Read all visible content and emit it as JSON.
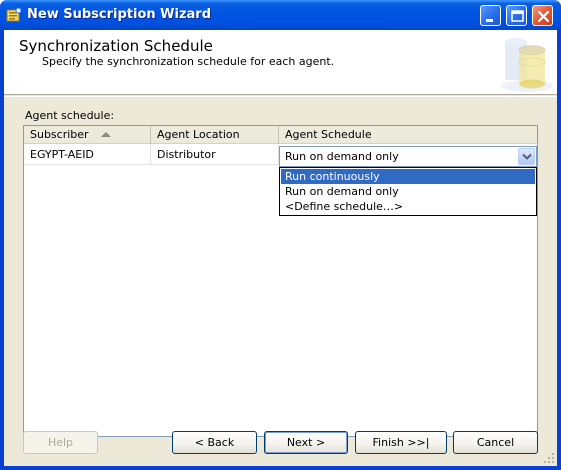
{
  "window": {
    "title": "New Subscription Wizard"
  },
  "header": {
    "title": "Synchronization Schedule",
    "subtitle": "Specify the synchronization schedule for each agent."
  },
  "agent_schedule": {
    "label": "Agent schedule:",
    "columns": [
      "Subscriber",
      "Agent Location",
      "Agent Schedule"
    ],
    "sort_column": "Subscriber",
    "rows": [
      {
        "subscriber": "EGYPT-AEID",
        "agent_location": "Distributor",
        "agent_schedule": "Run on demand only"
      }
    ],
    "dropdown_options": [
      "Run continuously",
      "Run on demand only",
      "<Define schedule…>"
    ],
    "highlighted_option": "Run continuously"
  },
  "buttons": {
    "help": "Help",
    "back": "< Back",
    "next": "Next >",
    "finish": "Finish >>|",
    "cancel": "Cancel"
  },
  "icons": {
    "title": "wizard-app-icon",
    "minimize": "minimize-icon",
    "maximize": "maximize-icon",
    "close": "close-icon",
    "header": "database-banner-icon",
    "combo": "chevron-down-icon",
    "sort": "sort-ascending-icon"
  },
  "colors": {
    "titlebar": "#0054e3",
    "selection": "#316ac5",
    "dialog_background": "#ece9d8"
  }
}
